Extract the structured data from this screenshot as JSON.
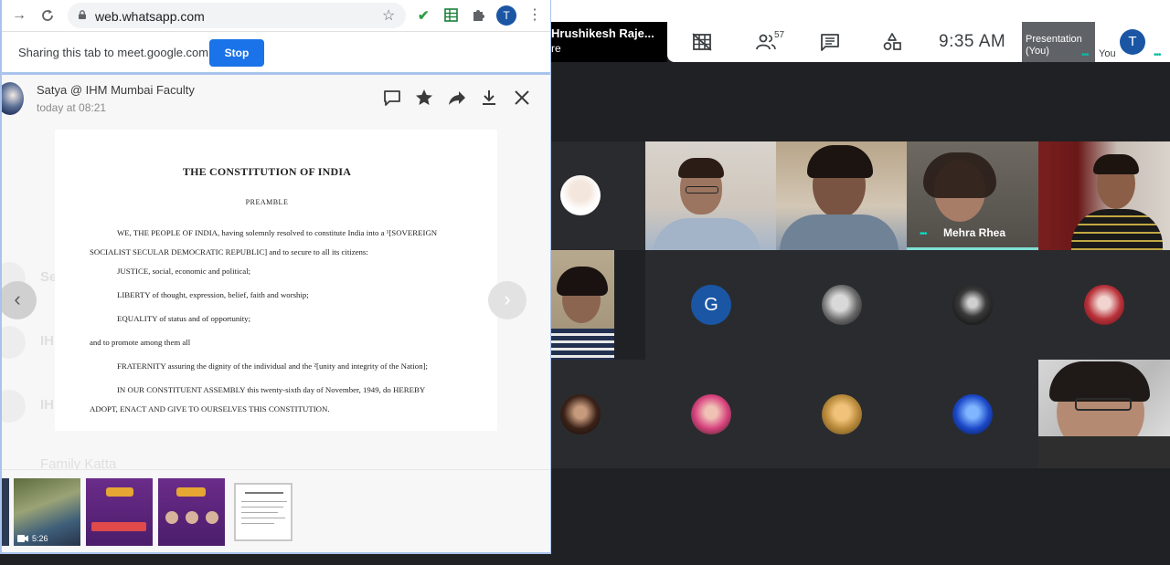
{
  "browser": {
    "url": "web.whatsapp.com",
    "account_initial": "T"
  },
  "share_bar": {
    "message": "Sharing this tab to meet.google.com",
    "stop_label": "Stop"
  },
  "viewer": {
    "sender": "Satya @ IHM Mumbai Faculty",
    "timestamp": "today at 08:21",
    "background_chat": {
      "items": [
        "Se",
        "IH",
        "IH",
        "Family Katta"
      ]
    }
  },
  "document": {
    "title": "THE CONSTITUTION OF INDIA",
    "subtitle": "PREAMBLE",
    "lines": [
      "WE, THE PEOPLE OF INDIA, having solemnly resolved to constitute India into a ¹[SOVEREIGN",
      "SOCIALIST SECULAR DEMOCRATIC REPUBLIC] and to secure to all its citizens:",
      "JUSTICE, social, economic and political;",
      "LIBERTY of thought, expression, belief, faith and worship;",
      "EQUALITY of status and of opportunity;",
      "and to promote among them all",
      "FRATERNITY assuring the dignity of the individual and the ²[unity and integrity of the Nation];",
      "IN OUR CONSTITUENT ASSEMBLY this twenty-sixth day of November, 1949, do HEREBY",
      "ADOPT, ENACT AND GIVE TO OURSELVES THIS CONSTITUTION."
    ]
  },
  "thumbnails": {
    "video_duration": "5:26"
  },
  "meet": {
    "presenter_name": "Hrushikesh Raje...",
    "presenter_sub": "re",
    "participant_count": "57",
    "time": "9:35  AM",
    "presentation_label": "Presentation (You)",
    "you_label": "You",
    "you_initial": "T",
    "tiles": {
      "mehra_name": "Mehra Rhea",
      "g_initial": "G"
    }
  },
  "colors": {
    "share_stop": "#1a73e8",
    "meet_bg": "#202124",
    "avatar_blue": "#1a56a4",
    "speaking": "#7fe0d5"
  }
}
